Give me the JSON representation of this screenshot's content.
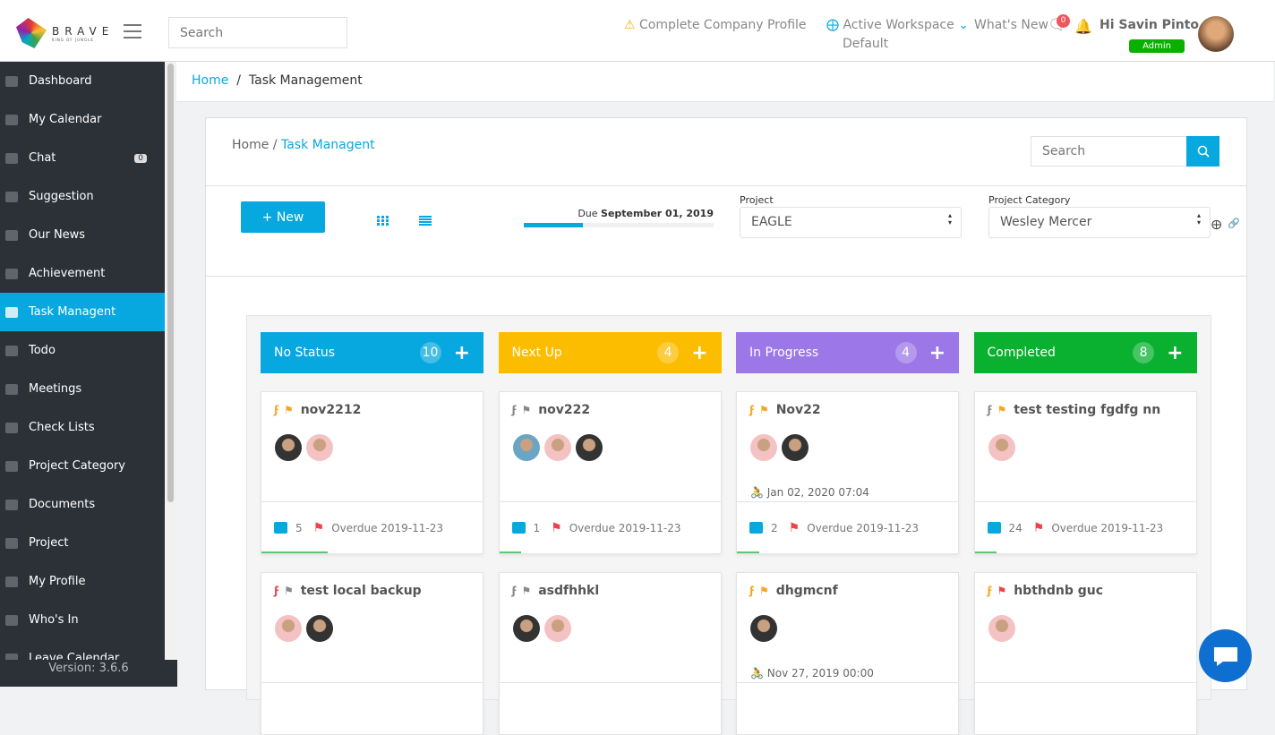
{
  "header": {
    "brand": "BRAVE",
    "tagline": "KING OF JUNGLE",
    "search_placeholder": "Search",
    "complete_profile": "Complete Company Profile",
    "workspace_label": "Active Workspace",
    "workspace_value": "Default",
    "whats_new": "What's New",
    "chat_badge": "0",
    "greeting": "Hi Savin Pinto",
    "role": "Admin"
  },
  "sidebar": {
    "items": [
      {
        "label": "Dashboard"
      },
      {
        "label": "My Calendar"
      },
      {
        "label": "Chat",
        "count": "0"
      },
      {
        "label": "Suggestion"
      },
      {
        "label": "Our News"
      },
      {
        "label": "Achievement"
      },
      {
        "label": "Task Managent",
        "active": true
      },
      {
        "label": "Todo"
      },
      {
        "label": "Meetings"
      },
      {
        "label": "Check Lists"
      },
      {
        "label": "Project Category"
      },
      {
        "label": "Documents"
      },
      {
        "label": "Project"
      },
      {
        "label": "My Profile"
      },
      {
        "label": "Who's In"
      },
      {
        "label": "Leave Calendar"
      }
    ],
    "version": "Version: 3.6.6"
  },
  "breadcrumb": {
    "home": "Home",
    "sep": "/",
    "current": "Task Management"
  },
  "panel": {
    "crumb_home": "Home /",
    "crumb_current": "Task Managent",
    "search_placeholder": "Search"
  },
  "toolbar": {
    "new_label": "+ New",
    "due_prefix": "Due",
    "due_date": "September 01, 2019",
    "progress_percent": 31,
    "project_label": "Project",
    "project_value": "EAGLE",
    "category_label": "Project Category",
    "category_value": "Wesley Mercer"
  },
  "columns": [
    {
      "title": "No Status",
      "count": "10",
      "color": "#07a8df",
      "cards": [
        {
          "title": "nov2212",
          "flag": "#f5a623",
          "bolt": "#f5a623",
          "avatars": [
            "#333",
            "#f4c2c2"
          ],
          "comments": "5",
          "overdue": "Overdue 2019-11-23",
          "progress": 30
        },
        {
          "title": "test local backup",
          "flag": "#888",
          "bolt": "#f0404a",
          "avatars": [
            "#f4c2c2",
            "#333"
          ]
        }
      ]
    },
    {
      "title": "Next Up",
      "count": "4",
      "color": "#fcbd00",
      "cards": [
        {
          "title": "nov222",
          "flag": "#888",
          "bolt": "#888",
          "avatars": [
            "#6aa5c6",
            "#f4c2c2",
            "#333"
          ],
          "comments": "1",
          "overdue": "Overdue 2019-11-23",
          "progress": 10
        },
        {
          "title": "asdfhhkl",
          "flag": "#888",
          "bolt": "#888",
          "avatars": [
            "#333",
            "#f4c2c2"
          ]
        }
      ]
    },
    {
      "title": "In Progress",
      "count": "4",
      "color": "#9b77e8",
      "cards": [
        {
          "title": "Nov22",
          "flag": "#f5a623",
          "bolt": "#f5a623",
          "avatars": [
            "#f4c2c2",
            "#333"
          ],
          "date": "Jan 02, 2020 07:04",
          "comments": "2",
          "overdue": "Overdue 2019-11-23",
          "progress": 10
        },
        {
          "title": "dhgmcnf",
          "flag": "#f5a623",
          "bolt": "#f5a623",
          "avatars": [
            "#333"
          ],
          "date": "Nov 27, 2019 00:00"
        }
      ]
    },
    {
      "title": "Completed",
      "count": "8",
      "color": "#0ab02f",
      "cards": [
        {
          "title": "test testing fgdfg nn",
          "flag": "#f5a623",
          "bolt": "#888",
          "avatars": [
            "#f4c2c2"
          ],
          "comments": "24",
          "overdue": "Overdue 2019-11-23",
          "progress": 10
        },
        {
          "title": "hbthdnb guc",
          "flag": "#f0404a",
          "bolt": "#f5a623",
          "avatars": [
            "#f4c2c2"
          ]
        }
      ]
    }
  ]
}
